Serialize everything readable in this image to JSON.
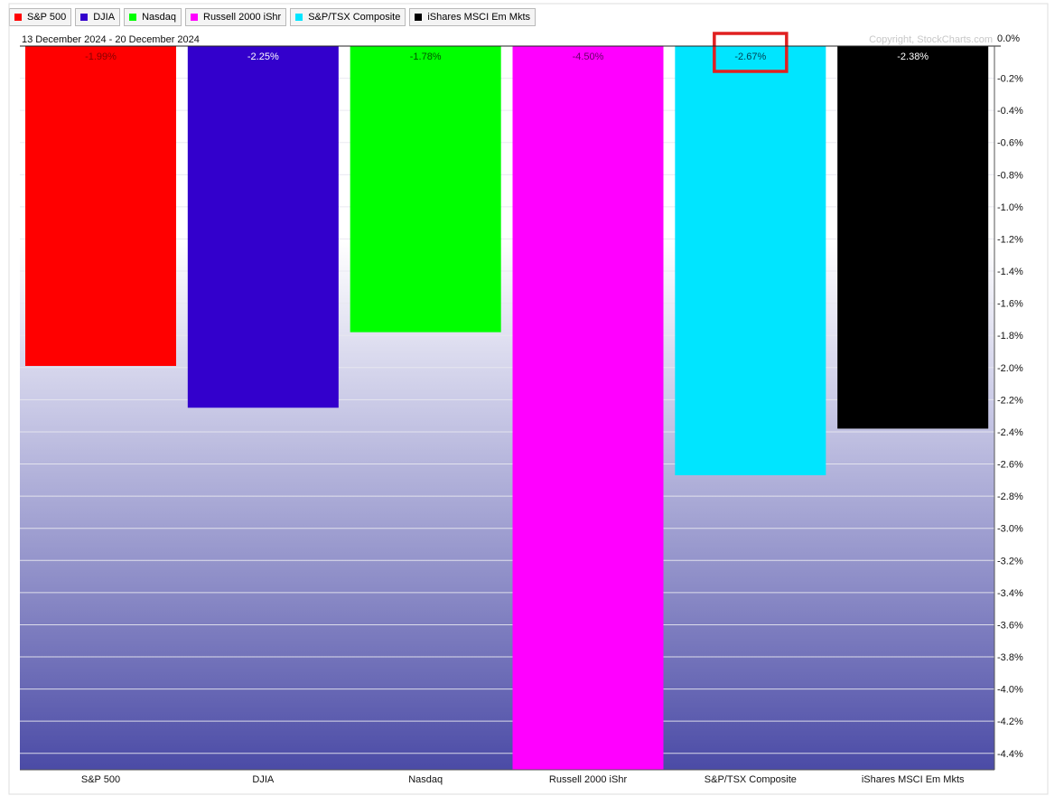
{
  "legend": [
    {
      "label": "S&P 500",
      "color": "#ff0000"
    },
    {
      "label": "DJIA",
      "color": "#3300cc"
    },
    {
      "label": "Nasdaq",
      "color": "#00ff00"
    },
    {
      "label": "Russell 2000 iShr",
      "color": "#ff00ff"
    },
    {
      "label": "S&P/TSX Composite",
      "color": "#00e5ff"
    },
    {
      "label": "iShares MSCI Em Mkts",
      "color": "#000000"
    }
  ],
  "header": {
    "date_range": "13 December 2024 - 20 December 2024",
    "copyright": "Copyright, StockCharts.com"
  },
  "chart_data": {
    "type": "bar",
    "categories": [
      "S&P 500",
      "DJIA",
      "Nasdaq",
      "Russell 2000 iShr",
      "S&P/TSX Composite",
      "iShares MSCI Em Mkts"
    ],
    "values": [
      -1.99,
      -2.25,
      -1.78,
      -4.5,
      -2.67,
      -2.38
    ],
    "data_labels": [
      "-1.99%",
      "-2.25%",
      "-1.78%",
      "-4.50%",
      "-2.67%",
      "-2.38%"
    ],
    "colors": [
      "#ff0000",
      "#3300cc",
      "#00ff00",
      "#ff00ff",
      "#00e5ff",
      "#000000"
    ],
    "label_colors": [
      "#880000",
      "#ffffff",
      "#005500",
      "#660066",
      "#004455",
      "#ffffff"
    ],
    "ylim": [
      -4.5,
      0
    ],
    "yticks": [
      0,
      -0.2,
      -0.4,
      -0.6,
      -0.8,
      -1.0,
      -1.2,
      -1.4,
      -1.6,
      -1.8,
      -2.0,
      -2.2,
      -2.4,
      -2.6,
      -2.8,
      -3.0,
      -3.2,
      -3.4,
      -3.6,
      -3.8,
      -4.0,
      -4.2,
      -4.4
    ],
    "ytick_labels": [
      "0.0%",
      "-0.2%",
      "-0.4%",
      "-0.6%",
      "-0.8%",
      "-1.0%",
      "-1.2%",
      "-1.4%",
      "-1.6%",
      "-1.8%",
      "-2.0%",
      "-2.2%",
      "-2.4%",
      "-2.6%",
      "-2.8%",
      "-3.0%",
      "-3.2%",
      "-3.4%",
      "-3.6%",
      "-3.8%",
      "-4.0%",
      "-4.2%",
      "-4.4%"
    ],
    "grid": true,
    "highlight_index": 4,
    "highlight_color": "#e02020"
  }
}
